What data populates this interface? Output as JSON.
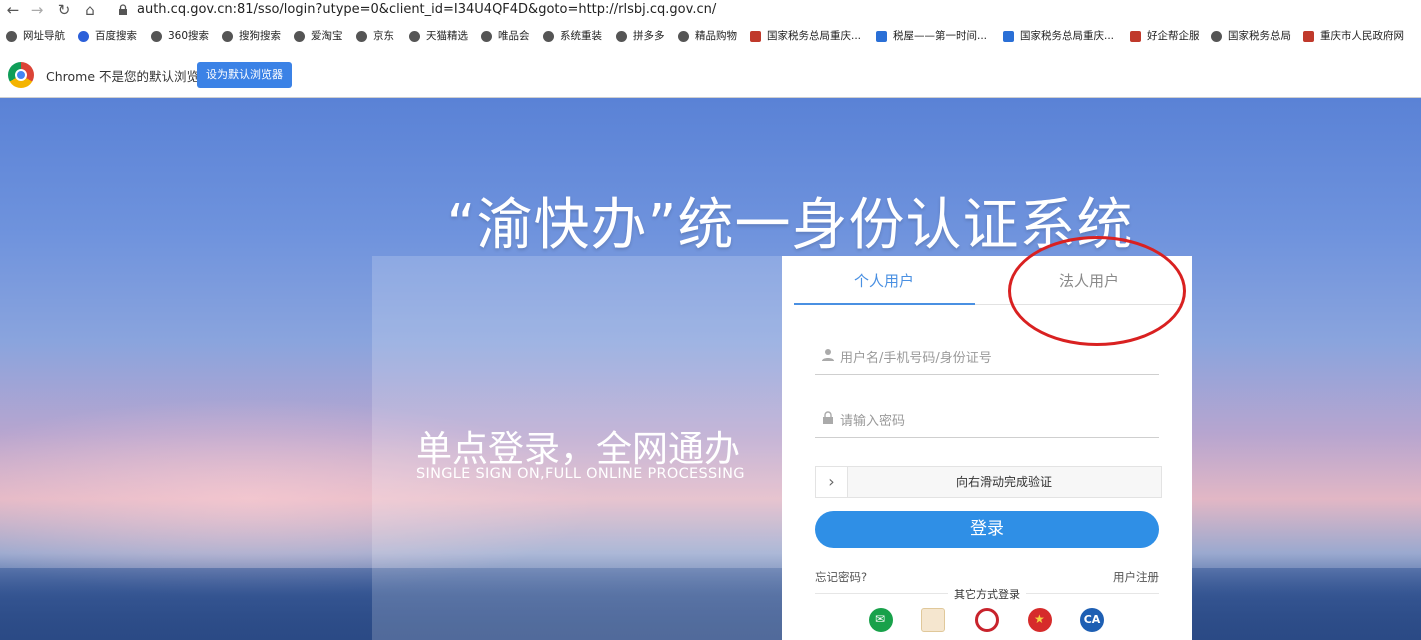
{
  "browser": {
    "url": "auth.cq.gov.cn:81/sso/login?utype=0&client_id=I34U4QF4D&goto=http://rlsbj.cq.gov.cn/",
    "bookmarks": [
      "网址导航",
      "百度搜索",
      "360搜索",
      "搜狗搜索",
      "爱淘宝",
      "京东",
      "天猫精选",
      "唯品会",
      "系统重装",
      "拼多多",
      "精品购物",
      "国家税务总局重庆...",
      "税屋——第一时间...",
      "国家税务总局重庆...",
      "好企帮企服",
      "国家税务总局",
      "重庆市人民政府网"
    ],
    "infobar_text": "Chrome 不是您的默认浏览器",
    "infobar_button": "设为默认浏览器"
  },
  "hero": {
    "title": "“渝快办”统一身份认证系统",
    "slogan": "单点登录，全网通办",
    "slogan_en": "SINGLE SIGN ON,FULL ONLINE PROCESSING"
  },
  "login": {
    "tabs": [
      {
        "label": "个人用户",
        "active": true
      },
      {
        "label": "法人用户",
        "active": false
      }
    ],
    "username_placeholder": "用户名/手机号码/身份证号",
    "password_placeholder": "请输入密码",
    "slider_text": "向右滑动完成验证",
    "login_button": "登录",
    "forgot": "忘记密码?",
    "register": "用户注册",
    "other_login": "其它方式登录",
    "other_icons": [
      "wechat-icon",
      "bank-icon",
      "badge-icon",
      "national-emblem-icon",
      "ca-icon"
    ],
    "ca_label": "CA"
  },
  "colors": {
    "accent": "#4a90e2",
    "login_button": "#2f8fe6",
    "annotation": "#d92121"
  }
}
